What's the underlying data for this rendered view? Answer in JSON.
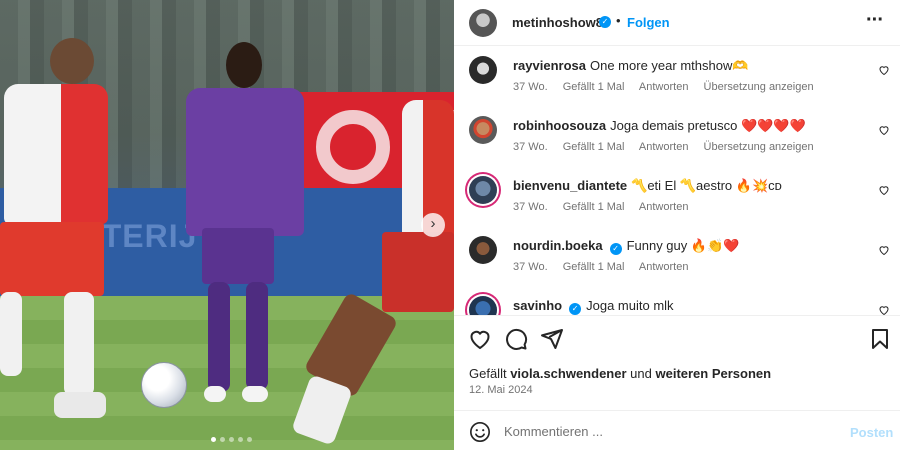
{
  "post": {
    "author": "metinhoshow8",
    "verified": true,
    "separator": "•",
    "follow_label": "Folgen",
    "more_icon": "more-horizontal-icon",
    "photo": {
      "description_icon": "photo-carousel",
      "next_icon": "chevron-right-icon",
      "slide_count": 5,
      "active_slide": 1
    }
  },
  "comments": [
    {
      "user": "rayvienrosa",
      "verified": false,
      "text": "One more year mthshow🫶",
      "age": "37 Wo.",
      "likes": "Gefällt 1 Mal",
      "reply": "Antworten",
      "translate": "Übersetzung anzeigen"
    },
    {
      "user": "robinhoosouza",
      "verified": false,
      "text": "Joga demais pretusco ❤️❤️❤️❤️",
      "age": "37 Wo.",
      "likes": "Gefällt 1 Mal",
      "reply": "Antworten",
      "translate": "Übersetzung anzeigen"
    },
    {
      "user": "bienvenu_diantete",
      "verified": false,
      "text": "〽️eti El 〽️aestro 🔥💥ᴄᴅ",
      "age": "37 Wo.",
      "likes": "Gefällt 1 Mal",
      "reply": "Antworten",
      "translate": ""
    },
    {
      "user": "nourdin.boeka",
      "verified": true,
      "text": "Funny guy 🔥👏❤️",
      "age": "37 Wo.",
      "likes": "Gefällt 1 Mal",
      "reply": "Antworten",
      "translate": ""
    },
    {
      "user": "savinho",
      "verified": true,
      "text": "Joga muito mlk",
      "age": "",
      "likes": "",
      "reply": "",
      "translate": ""
    }
  ],
  "actions": {
    "like_icon": "heart-icon",
    "comment_icon": "comment-icon",
    "share_icon": "send-icon",
    "save_icon": "bookmark-icon"
  },
  "likes_line": {
    "prefix": "Gefällt",
    "user": "viola.schwendener",
    "middle": "und",
    "suffix": "weiteren Personen"
  },
  "date": "12. Mai 2024",
  "composer": {
    "emoji_icon": "emoji-icon",
    "placeholder": "Kommentieren ...",
    "post_label": "Posten"
  },
  "colors": {
    "accent": "#0095f6",
    "post_disabled": "#b2dffc",
    "meta_text": "#737373",
    "story_ring": "#d62976"
  }
}
